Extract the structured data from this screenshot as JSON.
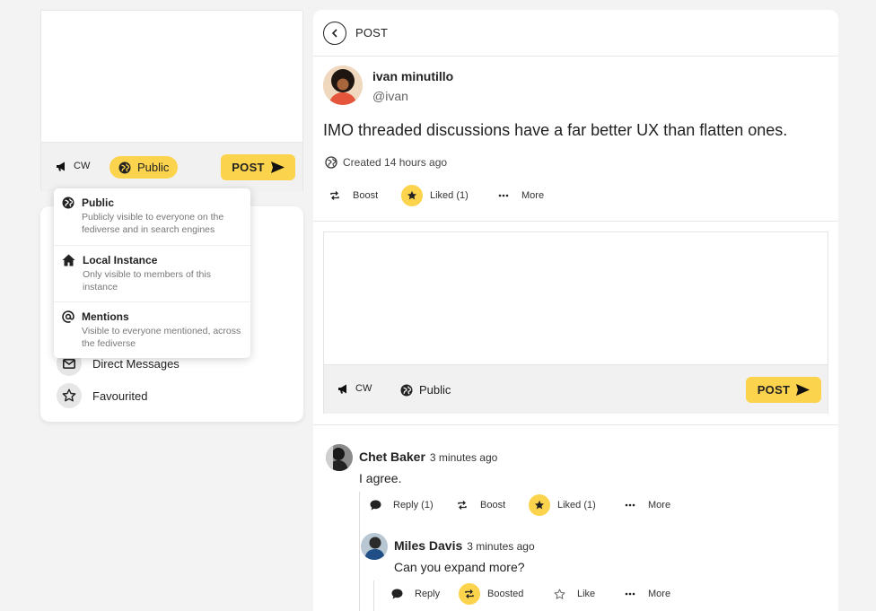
{
  "left_composer": {
    "cw_label": "CW",
    "visibility_label": "Public",
    "post_label": "POST"
  },
  "visibility_dropdown": {
    "options": [
      {
        "title": "Public",
        "desc": "Publicly visible to everyone on the fediverse and in search engines",
        "icon": "globe-icon"
      },
      {
        "title": "Local Instance",
        "desc": "Only visible to members of this instance",
        "icon": "home-icon"
      },
      {
        "title": "Mentions",
        "desc": "Visible to everyone mentioned, across the fediverse",
        "icon": "at-icon"
      }
    ]
  },
  "left_nav": {
    "items": [
      {
        "label": "Direct Messages",
        "icon": "envelope-icon"
      },
      {
        "label": "Favourited",
        "icon": "star-icon"
      }
    ]
  },
  "main": {
    "header_title": "POST",
    "post": {
      "author_name": "ivan minutillo",
      "author_handle": "@ivan",
      "text": "IMO threaded discussions have a far better UX than flatten ones.",
      "created": "Created 14 hours ago",
      "actions": {
        "boost": "Boost",
        "liked": "Liked (1)",
        "more": "More"
      }
    },
    "reply_composer": {
      "cw_label": "CW",
      "visibility_label": "Public",
      "post_label": "POST"
    },
    "comments": [
      {
        "author": "Chet Baker",
        "time": "3 minutes ago",
        "text": "I agree.",
        "actions": {
          "reply": "Reply (1)",
          "boost": "Boost",
          "liked": "Liked (1)",
          "more": "More"
        }
      },
      {
        "author": "Miles Davis",
        "time": "3 minutes ago",
        "text": "Can you expand more?",
        "actions": {
          "reply": "Reply",
          "boosted": "Boosted",
          "like": "Like",
          "more": "More"
        }
      }
    ]
  },
  "colors": {
    "accent": "#fcd34d",
    "background": "#f3f3f3"
  }
}
